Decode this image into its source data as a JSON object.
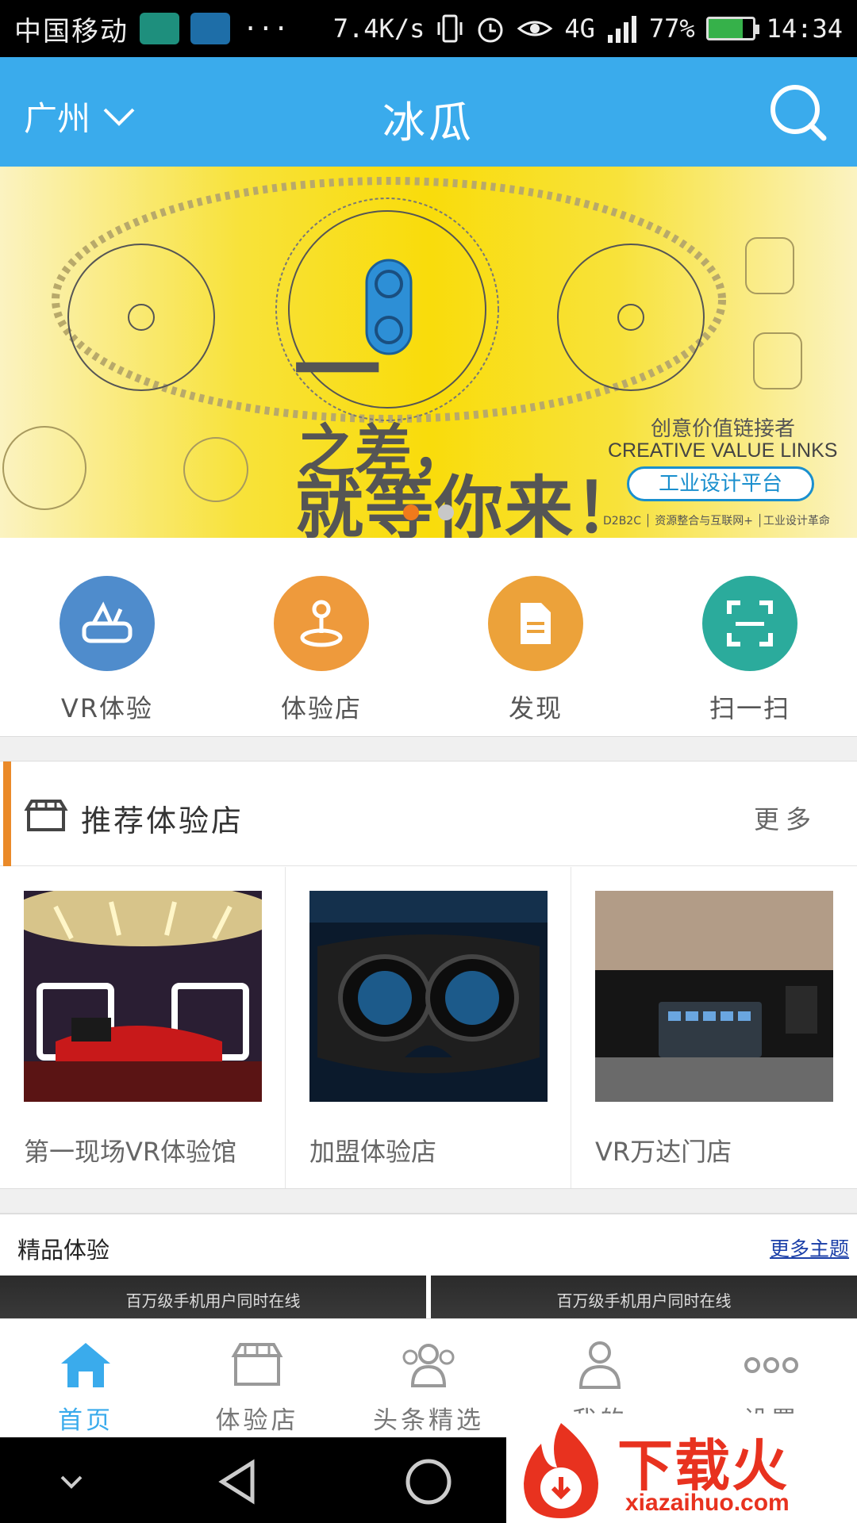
{
  "status_bar": {
    "carrier": "中国移动",
    "speed": "7.4K/s",
    "network": "4G",
    "battery": "77%",
    "battery_level": 0.77,
    "time": "14:34",
    "more": "···"
  },
  "header": {
    "city": "广州",
    "title": "冰瓜"
  },
  "banner": {
    "line1": "之差，",
    "line2": "就等你来！",
    "dash": "一",
    "brand_cn": "创意价值链接者",
    "brand_en": "CREATIVE VALUE LINKS",
    "pill": "工业设计平台",
    "footer": "D2B2C │ 资源整合与互联网+ │工业设计革命",
    "active_slide": 1,
    "slide_count": 2
  },
  "quick_menu": [
    {
      "label": "VR体验",
      "color": "#4f8ccc",
      "icon": "vr-icon"
    },
    {
      "label": "体验店",
      "color": "#ee9a3c",
      "icon": "location-pin-icon"
    },
    {
      "label": "发现",
      "color": "#eca23a",
      "icon": "document-icon"
    },
    {
      "label": "扫一扫",
      "color": "#2bab9c",
      "icon": "scan-icon"
    }
  ],
  "recommended": {
    "title": "推荐体验店",
    "more": "更多",
    "stores": [
      {
        "name": "第一现场VR体验馆"
      },
      {
        "name": "加盟体验店"
      },
      {
        "name": "VR万达门店"
      }
    ]
  },
  "premium": {
    "title": "精品体验",
    "more": "更多主题",
    "cards": [
      {
        "caption": "百万级手机用户同时在线"
      },
      {
        "caption": "百万级手机用户同时在线"
      }
    ]
  },
  "tabbar": [
    {
      "label": "首页",
      "icon": "home-icon",
      "active": true
    },
    {
      "label": "体验店",
      "icon": "store-icon",
      "active": false
    },
    {
      "label": "头条精选",
      "icon": "people-icon",
      "active": false
    },
    {
      "label": "我的",
      "icon": "user-icon",
      "active": false
    },
    {
      "label": "设置",
      "icon": "more-dots-icon",
      "active": false
    }
  ],
  "watermark": {
    "text": "下载火",
    "url": "xiazaihuo.com"
  },
  "colors": {
    "primary": "#3aabec",
    "accent": "#ea8a29",
    "dot_active": "#f07a1c"
  }
}
